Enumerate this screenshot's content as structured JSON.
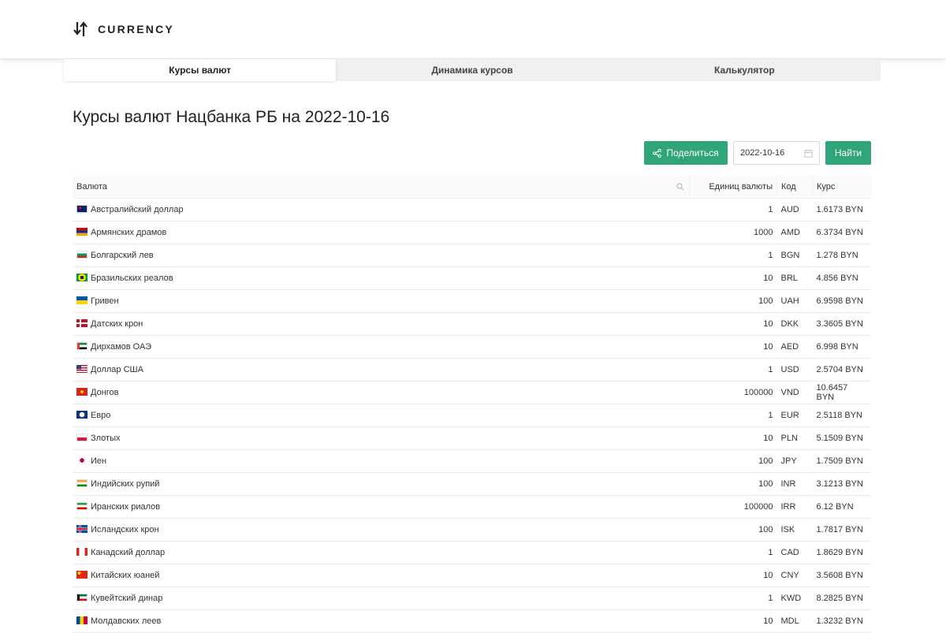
{
  "header": {
    "logo_text": "CURRENCY"
  },
  "tabs": [
    {
      "label": "Курсы валют",
      "active": true
    },
    {
      "label": "Динамика курсов",
      "active": false
    },
    {
      "label": "Калькулятор",
      "active": false
    }
  ],
  "page": {
    "title": "Курсы валют Нацбанка РБ на 2022-10-16"
  },
  "toolbar": {
    "share_label": "Поделиться",
    "date_value": "2022-10-16",
    "find_label": "Найти"
  },
  "colors": {
    "accent": "#2fa579"
  },
  "table": {
    "headers": {
      "currency": "Валюта",
      "units": "Единиц валюты",
      "code": "Код",
      "rate": "Курс"
    },
    "rows": [
      {
        "flag": "au",
        "name": "Австралийский доллар",
        "units": "1",
        "code": "AUD",
        "rate": "1.6173 BYN"
      },
      {
        "flag": "am",
        "name": "Армянских драмов",
        "units": "1000",
        "code": "AMD",
        "rate": "6.3734 BYN"
      },
      {
        "flag": "bg",
        "name": "Болгарский лев",
        "units": "1",
        "code": "BGN",
        "rate": "1.278 BYN"
      },
      {
        "flag": "br",
        "name": "Бразильских реалов",
        "units": "10",
        "code": "BRL",
        "rate": "4.856 BYN"
      },
      {
        "flag": "ua",
        "name": "Гривен",
        "units": "100",
        "code": "UAH",
        "rate": "6.9598 BYN"
      },
      {
        "flag": "dk",
        "name": "Датских крон",
        "units": "10",
        "code": "DKK",
        "rate": "3.3605 BYN"
      },
      {
        "flag": "ae",
        "name": "Дирхамов ОАЭ",
        "units": "10",
        "code": "AED",
        "rate": "6.998 BYN"
      },
      {
        "flag": "us",
        "name": "Доллар США",
        "units": "1",
        "code": "USD",
        "rate": "2.5704 BYN"
      },
      {
        "flag": "vn",
        "name": "Донгов",
        "units": "100000",
        "code": "VND",
        "rate": "10.6457 BYN"
      },
      {
        "flag": "eu",
        "name": "Евро",
        "units": "1",
        "code": "EUR",
        "rate": "2.5118 BYN"
      },
      {
        "flag": "pl",
        "name": "Злотых",
        "units": "10",
        "code": "PLN",
        "rate": "5.1509 BYN"
      },
      {
        "flag": "jp",
        "name": "Иен",
        "units": "100",
        "code": "JPY",
        "rate": "1.7509 BYN"
      },
      {
        "flag": "in",
        "name": "Индийских рупий",
        "units": "100",
        "code": "INR",
        "rate": "3.1213 BYN"
      },
      {
        "flag": "ir",
        "name": "Иранских риалов",
        "units": "100000",
        "code": "IRR",
        "rate": "6.12 BYN"
      },
      {
        "flag": "is",
        "name": "Исландских крон",
        "units": "100",
        "code": "ISK",
        "rate": "1.7817 BYN"
      },
      {
        "flag": "ca",
        "name": "Канадский доллар",
        "units": "1",
        "code": "CAD",
        "rate": "1.8629 BYN"
      },
      {
        "flag": "cn",
        "name": "Китайских юаней",
        "units": "10",
        "code": "CNY",
        "rate": "3.5608 BYN"
      },
      {
        "flag": "kw",
        "name": "Кувейтский динар",
        "units": "1",
        "code": "KWD",
        "rate": "8.2825 BYN"
      },
      {
        "flag": "md",
        "name": "Молдавских леев",
        "units": "10",
        "code": "MDL",
        "rate": "1.3232 BYN"
      }
    ]
  }
}
